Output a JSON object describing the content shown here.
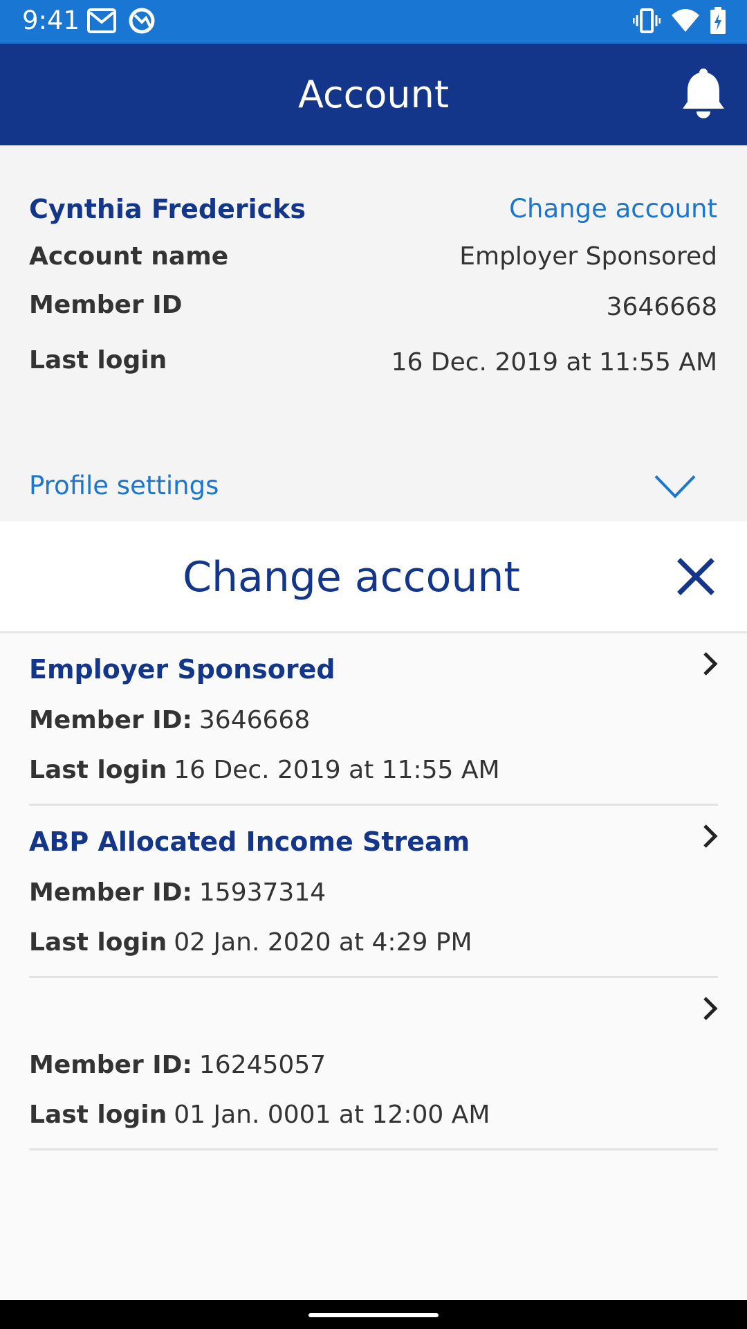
{
  "status_bar": {
    "time": "9:41",
    "icons": [
      "gmail-icon",
      "sync-icon",
      "vibrate-icon",
      "wifi-icon",
      "battery-charging-icon"
    ]
  },
  "app_bar": {
    "title": "Account",
    "action_icon": "bell-icon"
  },
  "profile": {
    "name": "Cynthia Fredericks",
    "change_account_link": "Change account",
    "rows": [
      {
        "label": "Account name",
        "value": "Employer Sponsored"
      },
      {
        "label": "Member ID",
        "value": "3646668"
      },
      {
        "label": "Last login",
        "value": "16 Dec. 2019 at 11:55 AM"
      }
    ],
    "settings_label": "Profile settings",
    "settings_icon": "chevron-down-icon"
  },
  "sheet": {
    "title": "Change account",
    "close_icon": "close-icon",
    "accounts": [
      {
        "title": "Employer Sponsored",
        "member_id_label": "Member ID:",
        "member_id": "3646668",
        "last_login_label": "Last login",
        "last_login": "16 Dec. 2019 at 11:55 AM"
      },
      {
        "title": "ABP Allocated Income Stream",
        "member_id_label": "Member ID:",
        "member_id": "15937314",
        "last_login_label": "Last login",
        "last_login": "02 Jan. 2020 at 4:29 PM"
      },
      {
        "title": "",
        "member_id_label": "Member ID:",
        "member_id": "16245057",
        "last_login_label": "Last login",
        "last_login": "01 Jan. 0001 at 12:00 AM"
      }
    ]
  },
  "colors": {
    "status_bar": "#1976d2",
    "app_bar": "#14368a",
    "accent_link": "#1976d2",
    "heading_blue": "#14368a"
  }
}
